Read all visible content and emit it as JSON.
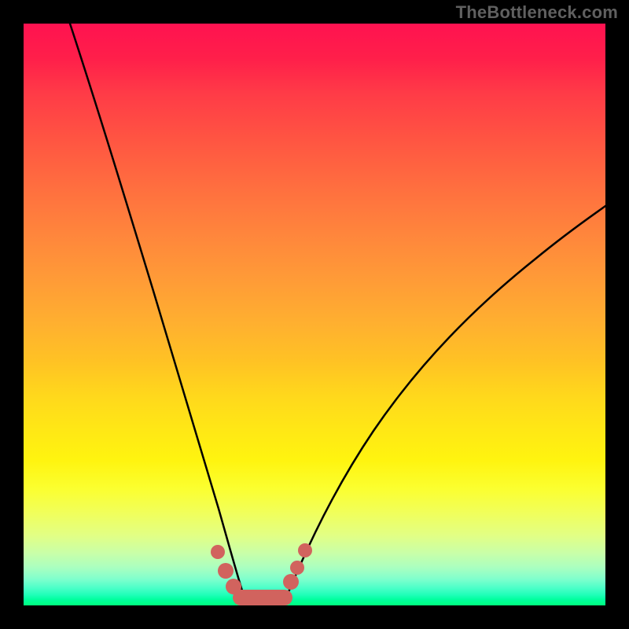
{
  "watermark": "TheBottleneck.com",
  "chart_data": {
    "type": "line",
    "title": "",
    "xlabel": "",
    "ylabel": "",
    "xlim": [
      0,
      100
    ],
    "ylim": [
      0,
      100
    ],
    "series": [
      {
        "name": "left-branch",
        "x": [
          8,
          12,
          16,
          20,
          24,
          28,
          30,
          32,
          34,
          35.5,
          37
        ],
        "y": [
          100,
          83,
          67,
          52,
          38,
          24,
          17,
          11,
          6,
          3,
          0
        ]
      },
      {
        "name": "right-branch",
        "x": [
          44,
          46,
          48,
          52,
          58,
          66,
          74,
          82,
          90,
          100
        ],
        "y": [
          0,
          3,
          6,
          12,
          20,
          30,
          40,
          49,
          57,
          66
        ]
      }
    ],
    "valley_floor": {
      "x_start": 37,
      "x_end": 44,
      "y": 0
    },
    "markers": [
      {
        "x": 33.0,
        "y": 9.5
      },
      {
        "x": 34.3,
        "y": 6.5
      },
      {
        "x": 45.8,
        "y": 5.0
      },
      {
        "x": 46.8,
        "y": 7.3
      },
      {
        "x": 48.4,
        "y": 10.0
      }
    ],
    "gradient_stops": [
      {
        "pos": 0,
        "color": "#ff1250"
      },
      {
        "pos": 50,
        "color": "#ffb12f"
      },
      {
        "pos": 80,
        "color": "#fbff30"
      },
      {
        "pos": 100,
        "color": "#00ff7e"
      }
    ]
  }
}
